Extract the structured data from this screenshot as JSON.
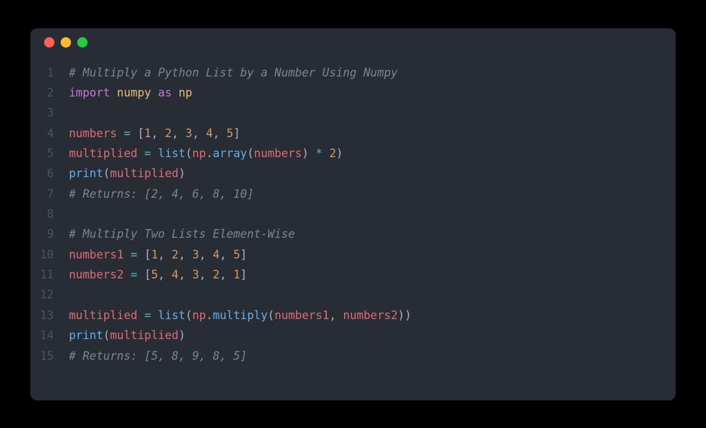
{
  "window": {
    "traffic_lights": [
      "red",
      "yellow",
      "green"
    ]
  },
  "code": {
    "lines": [
      {
        "num": "1",
        "tokens": [
          {
            "cls": "tok-comment",
            "text": "# Multiply a Python List by a Number Using Numpy"
          }
        ]
      },
      {
        "num": "2",
        "tokens": [
          {
            "cls": "tok-keyword",
            "text": "import"
          },
          {
            "cls": "",
            "text": " "
          },
          {
            "cls": "tok-module",
            "text": "numpy"
          },
          {
            "cls": "",
            "text": " "
          },
          {
            "cls": "tok-keyword",
            "text": "as"
          },
          {
            "cls": "",
            "text": " "
          },
          {
            "cls": "tok-module",
            "text": "np"
          }
        ]
      },
      {
        "num": "3",
        "tokens": []
      },
      {
        "num": "4",
        "tokens": [
          {
            "cls": "tok-var",
            "text": "numbers"
          },
          {
            "cls": "",
            "text": " "
          },
          {
            "cls": "tok-op",
            "text": "="
          },
          {
            "cls": "",
            "text": " "
          },
          {
            "cls": "tok-punct",
            "text": "["
          },
          {
            "cls": "tok-num",
            "text": "1"
          },
          {
            "cls": "tok-punct",
            "text": ", "
          },
          {
            "cls": "tok-num",
            "text": "2"
          },
          {
            "cls": "tok-punct",
            "text": ", "
          },
          {
            "cls": "tok-num",
            "text": "3"
          },
          {
            "cls": "tok-punct",
            "text": ", "
          },
          {
            "cls": "tok-num",
            "text": "4"
          },
          {
            "cls": "tok-punct",
            "text": ", "
          },
          {
            "cls": "tok-num",
            "text": "5"
          },
          {
            "cls": "tok-punct",
            "text": "]"
          }
        ]
      },
      {
        "num": "5",
        "tokens": [
          {
            "cls": "tok-var",
            "text": "multiplied"
          },
          {
            "cls": "",
            "text": " "
          },
          {
            "cls": "tok-op",
            "text": "="
          },
          {
            "cls": "",
            "text": " "
          },
          {
            "cls": "tok-func",
            "text": "list"
          },
          {
            "cls": "tok-punct",
            "text": "("
          },
          {
            "cls": "tok-var",
            "text": "np"
          },
          {
            "cls": "tok-punct",
            "text": "."
          },
          {
            "cls": "tok-func",
            "text": "array"
          },
          {
            "cls": "tok-punct",
            "text": "("
          },
          {
            "cls": "tok-var",
            "text": "numbers"
          },
          {
            "cls": "tok-punct",
            "text": ") "
          },
          {
            "cls": "tok-op",
            "text": "*"
          },
          {
            "cls": "",
            "text": " "
          },
          {
            "cls": "tok-num",
            "text": "2"
          },
          {
            "cls": "tok-punct",
            "text": ")"
          }
        ]
      },
      {
        "num": "6",
        "tokens": [
          {
            "cls": "tok-func",
            "text": "print"
          },
          {
            "cls": "tok-punct",
            "text": "("
          },
          {
            "cls": "tok-var",
            "text": "multiplied"
          },
          {
            "cls": "tok-punct",
            "text": ")"
          }
        ]
      },
      {
        "num": "7",
        "tokens": [
          {
            "cls": "tok-comment",
            "text": "# Returns: [2, 4, 6, 8, 10]"
          }
        ]
      },
      {
        "num": "8",
        "tokens": []
      },
      {
        "num": "9",
        "tokens": [
          {
            "cls": "tok-comment",
            "text": "# Multiply Two Lists Element-Wise"
          }
        ]
      },
      {
        "num": "10",
        "tokens": [
          {
            "cls": "tok-var",
            "text": "numbers1"
          },
          {
            "cls": "",
            "text": " "
          },
          {
            "cls": "tok-op",
            "text": "="
          },
          {
            "cls": "",
            "text": " "
          },
          {
            "cls": "tok-punct",
            "text": "["
          },
          {
            "cls": "tok-num",
            "text": "1"
          },
          {
            "cls": "tok-punct",
            "text": ", "
          },
          {
            "cls": "tok-num",
            "text": "2"
          },
          {
            "cls": "tok-punct",
            "text": ", "
          },
          {
            "cls": "tok-num",
            "text": "3"
          },
          {
            "cls": "tok-punct",
            "text": ", "
          },
          {
            "cls": "tok-num",
            "text": "4"
          },
          {
            "cls": "tok-punct",
            "text": ", "
          },
          {
            "cls": "tok-num",
            "text": "5"
          },
          {
            "cls": "tok-punct",
            "text": "]"
          }
        ]
      },
      {
        "num": "11",
        "tokens": [
          {
            "cls": "tok-var",
            "text": "numbers2"
          },
          {
            "cls": "",
            "text": " "
          },
          {
            "cls": "tok-op",
            "text": "="
          },
          {
            "cls": "",
            "text": " "
          },
          {
            "cls": "tok-punct",
            "text": "["
          },
          {
            "cls": "tok-num",
            "text": "5"
          },
          {
            "cls": "tok-punct",
            "text": ", "
          },
          {
            "cls": "tok-num",
            "text": "4"
          },
          {
            "cls": "tok-punct",
            "text": ", "
          },
          {
            "cls": "tok-num",
            "text": "3"
          },
          {
            "cls": "tok-punct",
            "text": ", "
          },
          {
            "cls": "tok-num",
            "text": "2"
          },
          {
            "cls": "tok-punct",
            "text": ", "
          },
          {
            "cls": "tok-num",
            "text": "1"
          },
          {
            "cls": "tok-punct",
            "text": "]"
          }
        ]
      },
      {
        "num": "12",
        "tokens": []
      },
      {
        "num": "13",
        "tokens": [
          {
            "cls": "tok-var",
            "text": "multiplied"
          },
          {
            "cls": "",
            "text": " "
          },
          {
            "cls": "tok-op",
            "text": "="
          },
          {
            "cls": "",
            "text": " "
          },
          {
            "cls": "tok-func",
            "text": "list"
          },
          {
            "cls": "tok-punct",
            "text": "("
          },
          {
            "cls": "tok-var",
            "text": "np"
          },
          {
            "cls": "tok-punct",
            "text": "."
          },
          {
            "cls": "tok-func",
            "text": "multiply"
          },
          {
            "cls": "tok-punct",
            "text": "("
          },
          {
            "cls": "tok-var",
            "text": "numbers1"
          },
          {
            "cls": "tok-punct",
            "text": ", "
          },
          {
            "cls": "tok-var",
            "text": "numbers2"
          },
          {
            "cls": "tok-punct",
            "text": "))"
          }
        ]
      },
      {
        "num": "14",
        "tokens": [
          {
            "cls": "tok-func",
            "text": "print"
          },
          {
            "cls": "tok-punct",
            "text": "("
          },
          {
            "cls": "tok-var",
            "text": "multiplied"
          },
          {
            "cls": "tok-punct",
            "text": ")"
          }
        ]
      },
      {
        "num": "15",
        "tokens": [
          {
            "cls": "tok-comment",
            "text": "# Returns: [5, 8, 9, 8, 5]"
          }
        ]
      }
    ]
  }
}
